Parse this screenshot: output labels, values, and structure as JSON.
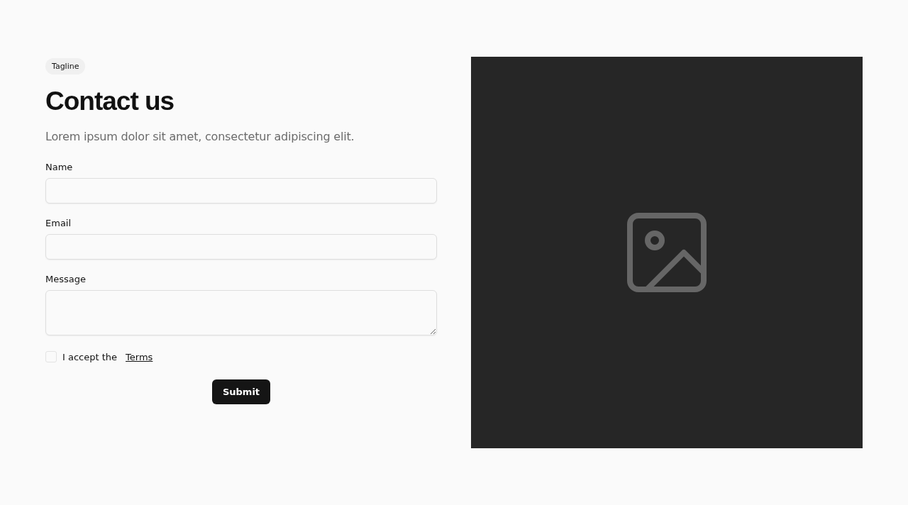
{
  "tagline": "Tagline",
  "title": "Contact us",
  "subtitle": "Lorem ipsum dolor sit amet, consectetur adipiscing elit.",
  "fields": [
    {
      "label": "Name",
      "kind": "text"
    },
    {
      "label": "Email",
      "kind": "text"
    },
    {
      "label": "Message",
      "kind": "textarea"
    }
  ],
  "terms": {
    "text": "I accept the",
    "link": "Terms",
    "checked": false
  },
  "submit": "Submit",
  "media": {
    "kind": "placeholder"
  }
}
